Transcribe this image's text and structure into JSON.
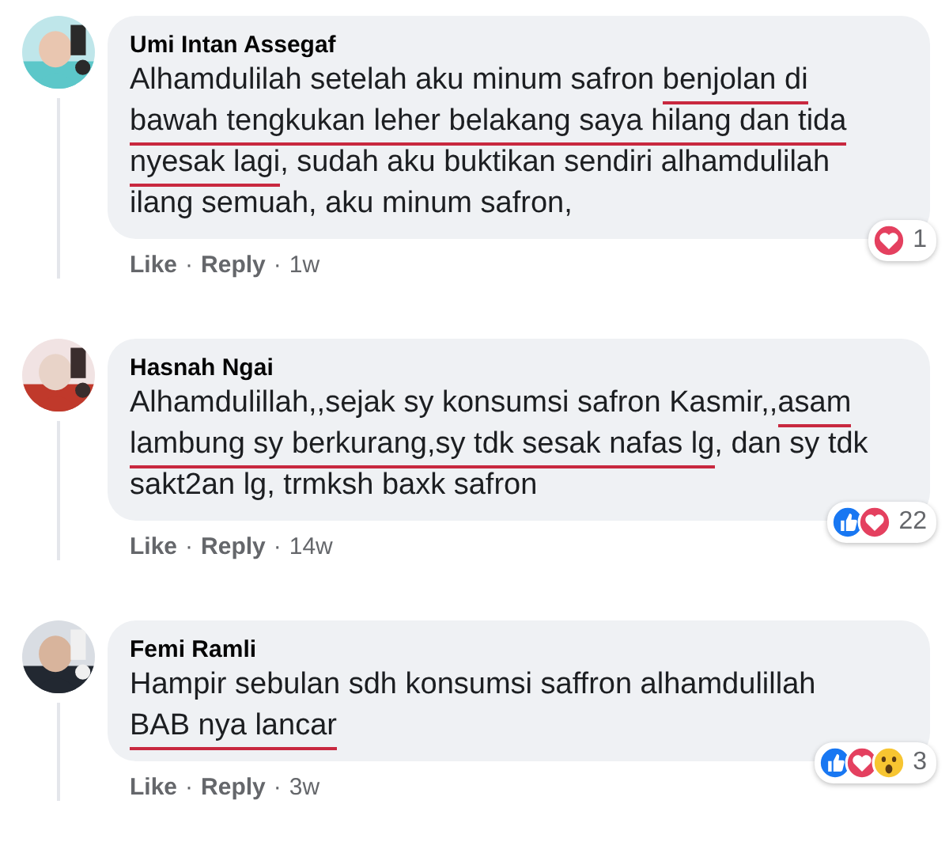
{
  "comments": [
    {
      "author": "Umi Intan Assegaf",
      "avatar": {
        "kind": "picture"
      },
      "lines": [
        [
          {
            "text": "Alhamdulilah setelah aku minum safron ",
            "underlined": false
          },
          {
            "text": "benjolan di",
            "underlined": true
          }
        ],
        [
          {
            "text": "bawah tengkukan leher belakang saya hilang dan tida",
            "underlined": true
          }
        ],
        [
          {
            "text": "nyesak lagi",
            "underlined": true
          },
          {
            "text": ", sudah aku buktikan sendiri alhamdulilah",
            "underlined": false
          }
        ],
        [
          {
            "text": "ilang semuah, aku minum safron,",
            "underlined": false
          }
        ]
      ],
      "reactions": {
        "icons": [
          {
            "kind": "love"
          }
        ],
        "count": "1"
      },
      "footer": [
        {
          "kind": "action",
          "text": "Like"
        },
        {
          "kind": "separator",
          "text": "·"
        },
        {
          "kind": "action",
          "text": "Reply"
        },
        {
          "kind": "separator",
          "text": "·"
        },
        {
          "kind": "time",
          "text": "1w"
        }
      ]
    },
    {
      "author": "Hasnah Ngai",
      "avatar": {
        "kind": "picture"
      },
      "lines": [
        [
          {
            "text": "Alhamdulillah,,sejak sy konsumsi safron Kasmir,,",
            "underlined": false
          },
          {
            "text": "asam",
            "underlined": true
          }
        ],
        [
          {
            "text": "lambung sy berkurang,sy tdk sesak nafas lg",
            "underlined": true
          },
          {
            "text": ", dan sy tdk",
            "underlined": false
          }
        ],
        [
          {
            "text": "sakt2an lg, trmksh baxk safron",
            "underlined": false
          }
        ]
      ],
      "reactions": {
        "icons": [
          {
            "kind": "like"
          },
          {
            "kind": "love"
          }
        ],
        "count": "22"
      },
      "footer": [
        {
          "kind": "action",
          "text": "Like"
        },
        {
          "kind": "separator",
          "text": "·"
        },
        {
          "kind": "action",
          "text": "Reply"
        },
        {
          "kind": "separator",
          "text": "·"
        },
        {
          "kind": "time",
          "text": "14w"
        }
      ]
    },
    {
      "author": "Femi Ramli",
      "avatar": {
        "kind": "picture"
      },
      "lines": [
        [
          {
            "text": "Hampir sebulan sdh konsumsi saffron alhamdulillah",
            "underlined": false
          }
        ],
        [
          {
            "text": "BAB nya lancar",
            "underlined": true
          }
        ]
      ],
      "reactions": {
        "icons": [
          {
            "kind": "like"
          },
          {
            "kind": "love"
          },
          {
            "kind": "wow"
          }
        ],
        "count": "3"
      },
      "footer": [
        {
          "kind": "action",
          "text": "Like"
        },
        {
          "kind": "separator",
          "text": "·"
        },
        {
          "kind": "action",
          "text": "Reply"
        },
        {
          "kind": "separator",
          "text": "·"
        },
        {
          "kind": "time",
          "text": "3w"
        }
      ]
    }
  ]
}
